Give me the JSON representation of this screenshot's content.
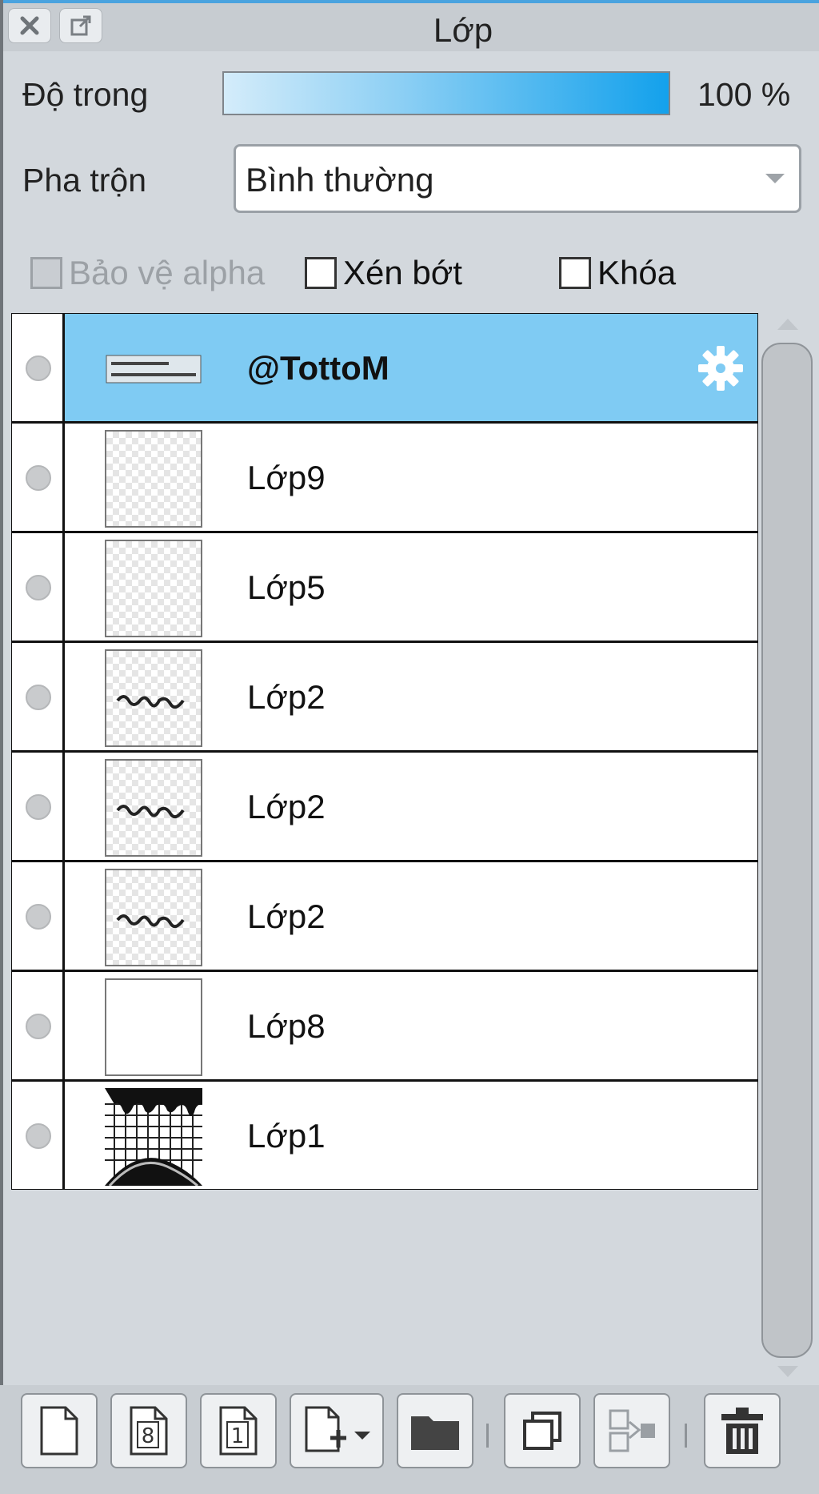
{
  "window": {
    "title": "Lớp"
  },
  "opacity": {
    "label": "Độ trong",
    "value_text": "100 %",
    "value": 100
  },
  "blend": {
    "label": "Pha trộn",
    "selected": "Bình thường"
  },
  "options": [
    {
      "label": "Bảo vệ alpha",
      "checked": false,
      "disabled": true
    },
    {
      "label": "Xén bớt",
      "checked": false,
      "disabled": false
    },
    {
      "label": "Khóa",
      "checked": false,
      "disabled": false
    }
  ],
  "layers": [
    {
      "name": "@TottoM",
      "selected": true,
      "thumbnail": "text-watermark",
      "has_settings": true
    },
    {
      "name": "Lớp9",
      "selected": false,
      "thumbnail": "transparent"
    },
    {
      "name": "Lớp5",
      "selected": false,
      "thumbnail": "transparent"
    },
    {
      "name": "Lớp2",
      "selected": false,
      "thumbnail": "script-text"
    },
    {
      "name": "Lớp2",
      "selected": false,
      "thumbnail": "script-text"
    },
    {
      "name": "Lớp2",
      "selected": false,
      "thumbnail": "script-text"
    },
    {
      "name": "Lớp8",
      "selected": false,
      "thumbnail": "white"
    },
    {
      "name": "Lớp1",
      "selected": false,
      "thumbnail": "grid-drip"
    }
  ],
  "toolbar": {
    "icons": [
      "new-layer-icon",
      "8bit-layer-icon",
      "1bit-layer-icon",
      "add-image-layer-icon",
      "folder-icon",
      "duplicate-layer-icon",
      "merge-down-icon",
      "trash-icon"
    ],
    "page8_glyph": "8",
    "page1_glyph": "1"
  },
  "colors": {
    "selected_row": "#7fcbf3",
    "opacity_fill_end": "#13a1ec",
    "list_background": "#808080"
  }
}
